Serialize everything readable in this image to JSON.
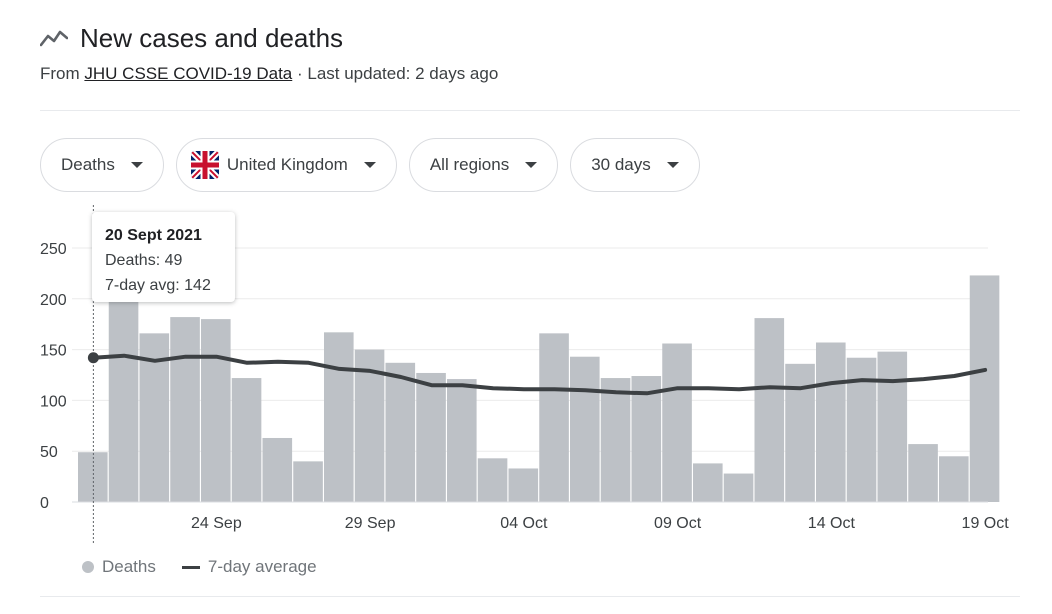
{
  "header": {
    "title": "New cases and deaths",
    "from_label": "From",
    "source_link": "JHU CSSE COVID-19 Data",
    "updated": "· Last updated: 2 days ago"
  },
  "filters": {
    "metric": "Deaths",
    "country": "United Kingdom",
    "region": "All regions",
    "range": "30 days"
  },
  "tooltip": {
    "date": "20 Sept 2021",
    "deaths": "Deaths: 49",
    "avg": "7-day avg: 142"
  },
  "legend": {
    "deaths": "Deaths",
    "average": "7-day average"
  },
  "colors": {
    "bars": "#bdc1c6",
    "avg_line": "#3c4043",
    "grid": "#ebebeb",
    "axis_text": "#3c4043"
  },
  "chart_data": {
    "type": "bar",
    "title": "",
    "xlabel": "",
    "ylabel": "",
    "ylim": [
      0,
      250
    ],
    "yticks": [
      0,
      50,
      100,
      150,
      200,
      250
    ],
    "x_start": "20 Sep",
    "x": [
      "20 Sep",
      "21 Sep",
      "22 Sep",
      "23 Sep",
      "24 Sep",
      "25 Sep",
      "26 Sep",
      "27 Sep",
      "28 Sep",
      "29 Sep",
      "30 Sep",
      "01 Oct",
      "02 Oct",
      "03 Oct",
      "04 Oct",
      "05 Oct",
      "06 Oct",
      "07 Oct",
      "08 Oct",
      "09 Oct",
      "10 Oct",
      "11 Oct",
      "12 Oct",
      "13 Oct",
      "14 Oct",
      "15 Oct",
      "16 Oct",
      "17 Oct",
      "18 Oct",
      "19 Oct"
    ],
    "xtick_labels": [
      "24 Sep",
      "29 Sep",
      "04 Oct",
      "09 Oct",
      "14 Oct",
      "19 Oct"
    ],
    "series": [
      {
        "name": "Deaths",
        "type": "bar",
        "values": [
          49,
          203,
          166,
          182,
          180,
          122,
          63,
          40,
          167,
          150,
          137,
          127,
          121,
          43,
          33,
          166,
          143,
          122,
          124,
          156,
          38,
          28,
          181,
          136,
          157,
          142,
          148,
          57,
          45,
          223
        ]
      },
      {
        "name": "7-day average",
        "type": "line",
        "values": [
          142,
          144,
          139,
          143,
          143,
          137,
          138,
          137,
          131,
          129,
          123,
          115,
          115,
          112,
          111,
          111,
          110,
          108,
          107,
          112,
          112,
          111,
          113,
          112,
          117,
          120,
          119,
          121,
          124,
          130
        ]
      }
    ],
    "highlight_index": 0,
    "legend_position": "bottom-left",
    "grid": true
  }
}
